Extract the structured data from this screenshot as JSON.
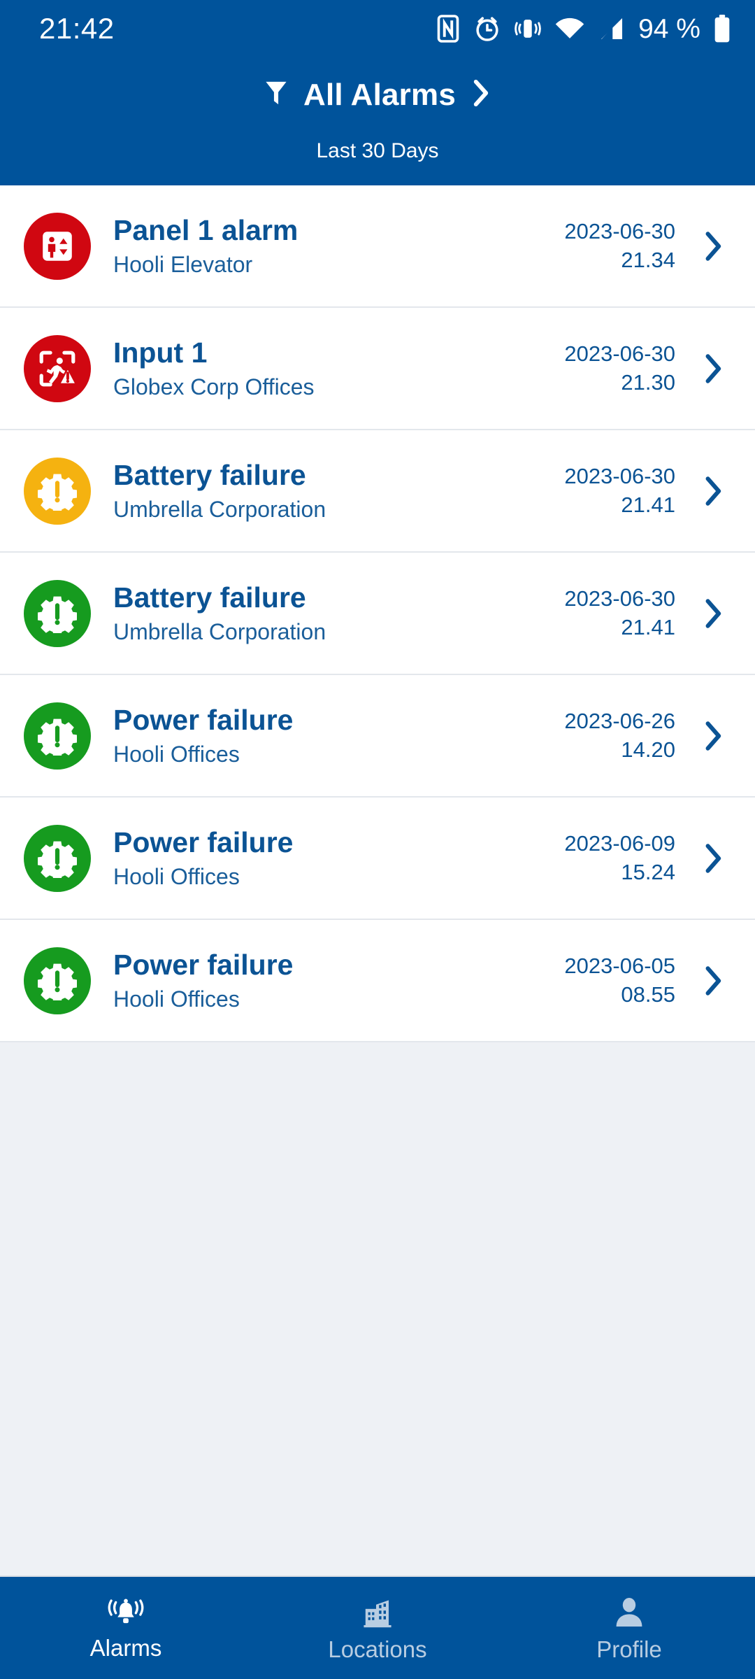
{
  "theme": {
    "header_blue": "#00539b",
    "page_bg": "#eef1f5",
    "row_bg": "#ffffff",
    "title_blue": "#0b5394",
    "sub_blue": "#1a5e9a",
    "alert_red": "#d00711",
    "alert_amber": "#f5b210",
    "alert_green": "#169b1f",
    "nav_inactive": "#b8cde2"
  },
  "statusbar": {
    "clock": "21:42",
    "battery_percent": "94 %",
    "icons": [
      "nfc-icon",
      "alarm-clock-icon",
      "vibrate-icon",
      "wifi-icon",
      "cellular-signal-icon",
      "battery-icon"
    ]
  },
  "header": {
    "filter_icon": "filter-icon",
    "filter_title": "All Alarms",
    "filter_chevron": "chevron-right-icon",
    "range_label": "Last 30 Days"
  },
  "alarms": [
    {
      "title": "Panel 1 alarm",
      "location": "Hooli Elevator",
      "date": "2023-06-30",
      "time": "21.34",
      "icon": "elevator-alarm-icon",
      "severity_color": "#d00711"
    },
    {
      "title": "Input 1",
      "location": "Globex Corp Offices",
      "date": "2023-06-30",
      "time": "21.30",
      "icon": "intrusion-detection-icon",
      "severity_color": "#d00711"
    },
    {
      "title": "Battery failure",
      "location": "Umbrella Corporation",
      "date": "2023-06-30",
      "time": "21.41",
      "icon": "gear-warning-icon",
      "severity_color": "#f5b210"
    },
    {
      "title": "Battery failure",
      "location": "Umbrella Corporation",
      "date": "2023-06-30",
      "time": "21.41",
      "icon": "gear-warning-icon",
      "severity_color": "#169b1f"
    },
    {
      "title": "Power failure",
      "location": "Hooli Offices",
      "date": "2023-06-26",
      "time": "14.20",
      "icon": "gear-warning-icon",
      "severity_color": "#169b1f"
    },
    {
      "title": "Power failure",
      "location": "Hooli Offices",
      "date": "2023-06-09",
      "time": "15.24",
      "icon": "gear-warning-icon",
      "severity_color": "#169b1f"
    },
    {
      "title": "Power failure",
      "location": "Hooli Offices",
      "date": "2023-06-05",
      "time": "08.55",
      "icon": "gear-warning-icon",
      "severity_color": "#169b1f"
    }
  ],
  "bottom_nav": {
    "items": [
      {
        "label": "Alarms",
        "icon": "bell-alert-icon",
        "active": true
      },
      {
        "label": "Locations",
        "icon": "building-icon",
        "active": false
      },
      {
        "label": "Profile",
        "icon": "person-icon",
        "active": false
      }
    ]
  }
}
